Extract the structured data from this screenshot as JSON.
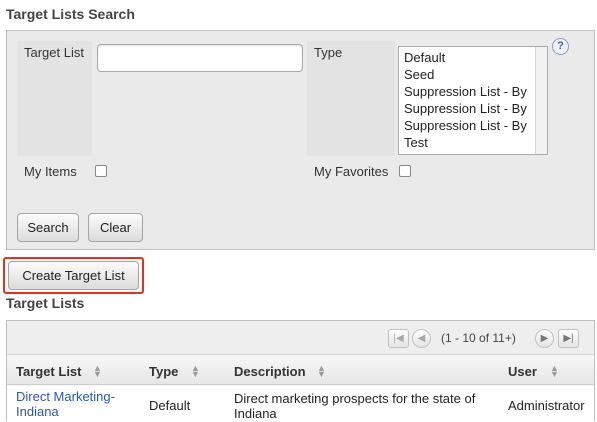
{
  "search": {
    "title": "Target Lists Search",
    "target_list_label": "Target List",
    "target_list_value": "",
    "type_label": "Type",
    "type_options": [
      "Default",
      "Seed",
      "Suppression List - By",
      "Suppression List - By",
      "Suppression List - By",
      "Test"
    ],
    "help_icon": "?",
    "my_items_label": "My Items",
    "my_favorites_label": "My Favorites",
    "search_button": "Search",
    "clear_button": "Clear"
  },
  "actions": {
    "create_button": "Create Target List",
    "highlight_color": "#e8301c"
  },
  "lists": {
    "title": "Target Lists",
    "pagination": {
      "first": "|◀",
      "prev": "◀",
      "range": "(1 - 10 of 11+)",
      "next": "▶",
      "last": "▶|"
    },
    "columns": [
      "Target List",
      "Type",
      "Description",
      "User"
    ],
    "rows": [
      {
        "name": "Direct Marketing- Indiana",
        "type": "Default",
        "description": "Direct marketing prospects for the state of Indiana",
        "user": "Administrator"
      }
    ],
    "link_color": "#2a58b0"
  }
}
